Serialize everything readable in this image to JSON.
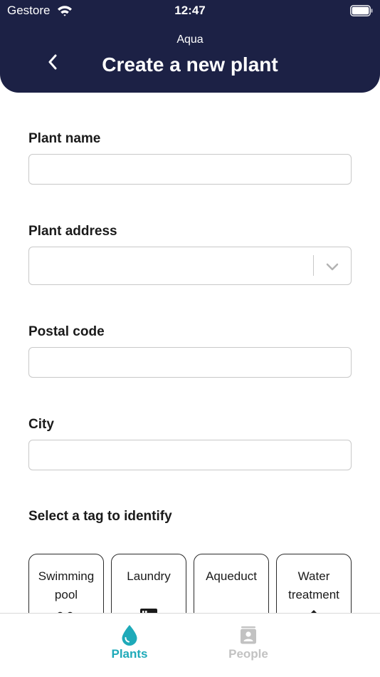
{
  "status_bar": {
    "carrier": "Gestore",
    "time": "12:47"
  },
  "header": {
    "app_name": "Aqua",
    "title": "Create a new plant"
  },
  "form": {
    "plant_name": {
      "label": "Plant name",
      "value": ""
    },
    "plant_address": {
      "label": "Plant address",
      "value": ""
    },
    "postal_code": {
      "label": "Postal code",
      "value": ""
    },
    "city": {
      "label": "City",
      "value": ""
    },
    "tag_section_label": "Select a tag to identify",
    "tags": [
      {
        "label": "Swimming pool",
        "icon": "pool-icon"
      },
      {
        "label": "Laundry",
        "icon": "washing-machine-icon"
      },
      {
        "label": "Aqueduct",
        "icon": "aqueduct-icon"
      },
      {
        "label": "Water treatment",
        "icon": "water-treatment-icon"
      }
    ]
  },
  "tab_bar": {
    "tabs": [
      {
        "label": "Plants",
        "icon": "water-drop-icon",
        "active": true
      },
      {
        "label": "People",
        "icon": "contact-card-icon",
        "active": false
      }
    ]
  },
  "colors": {
    "header_bg": "#1c2145",
    "accent": "#1eaab9",
    "inactive_tab": "#c2c2c2",
    "input_border": "#c8c8c8"
  }
}
